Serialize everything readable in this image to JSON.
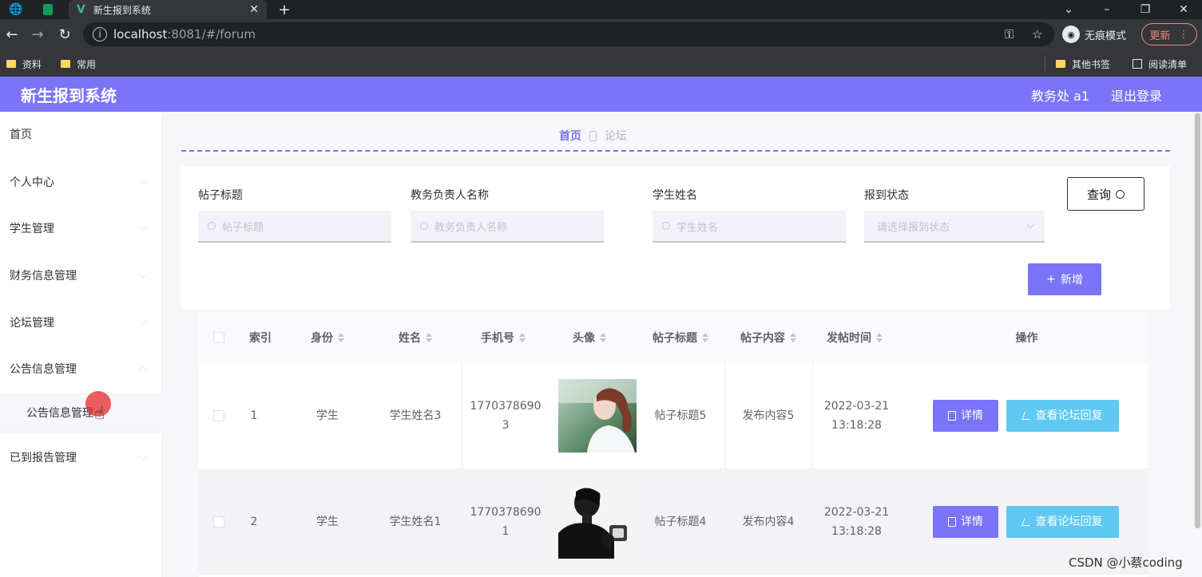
{
  "browser": {
    "tab_title": "新生报到系统",
    "url_host": "localhost",
    "url_path": ":8081/#/forum",
    "incognito_label": "无痕模式",
    "update_label": "更新",
    "bookmarks": [
      "资料",
      "常用"
    ],
    "other_bookmarks": "其他书签",
    "reading_list": "阅读清单"
  },
  "header": {
    "title": "新生报到系统",
    "user": "教务处 a1",
    "logout": "退出登录",
    "color": "#7a74f8"
  },
  "sidebar": {
    "items": [
      "首页",
      "个人中心",
      "学生管理",
      "财务信息管理",
      "论坛管理",
      "公告信息管理"
    ],
    "sub_item": "公告信息管理",
    "last_item": "已到报告管理"
  },
  "breadcrumb": {
    "home": "首页",
    "current": "论坛"
  },
  "search": {
    "fields": [
      {
        "label": "帖子标题",
        "placeholder": "帖子标题"
      },
      {
        "label": "教务负责人名称",
        "placeholder": "教务负责人名称"
      },
      {
        "label": "学生姓名",
        "placeholder": "学生姓名"
      },
      {
        "label": "报到状态",
        "placeholder": "请选择报到状态"
      }
    ],
    "query_label": "查询",
    "add_label": "新增"
  },
  "table": {
    "headers": [
      "索引",
      "身份",
      "姓名",
      "手机号",
      "头像",
      "帖子标题",
      "帖子内容",
      "发帖时间",
      "操作"
    ],
    "rows": [
      {
        "index": "1",
        "role": "学生",
        "name": "学生姓名3",
        "phone_a": "1770378690",
        "phone_b": "3",
        "title": "帖子标题5",
        "content": "发布内容5",
        "date": "2022-03-21",
        "time": "13:18:28"
      },
      {
        "index": "2",
        "role": "学生",
        "name": "学生姓名1",
        "phone_a": "1770378690",
        "phone_b": "1",
        "title": "帖子标题4",
        "content": "发布内容4",
        "date": "2022-03-21",
        "time": "13:18:28"
      }
    ],
    "detail_label": "详情",
    "reply_label": "查看论坛回复"
  },
  "watermark": "CSDN @小蔡coding"
}
